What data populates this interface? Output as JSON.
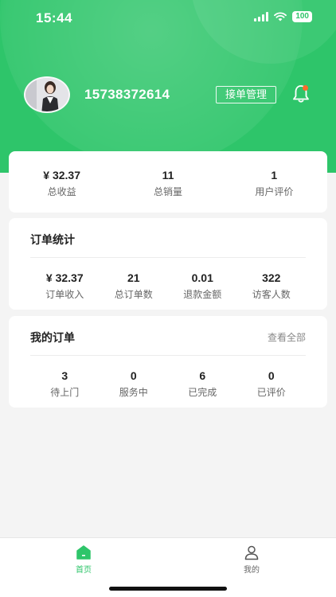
{
  "status_bar": {
    "time": "15:44",
    "battery": "100"
  },
  "profile": {
    "phone": "15738372614",
    "order_mgmt_label": "接单管理"
  },
  "summary": [
    {
      "value": "¥ 32.37",
      "label": "总收益"
    },
    {
      "value": "11",
      "label": "总销量"
    },
    {
      "value": "1",
      "label": "用户评价"
    }
  ],
  "order_stats": {
    "title": "订单统计",
    "items": [
      {
        "value": "¥ 32.37",
        "label": "订单收入"
      },
      {
        "value": "21",
        "label": "总订单数"
      },
      {
        "value": "0.01",
        "label": "退款金额"
      },
      {
        "value": "322",
        "label": "访客人数"
      }
    ]
  },
  "my_orders": {
    "title": "我的订单",
    "view_all": "查看全部",
    "items": [
      {
        "value": "3",
        "label": "待上门"
      },
      {
        "value": "0",
        "label": "服务中"
      },
      {
        "value": "6",
        "label": "已完成"
      },
      {
        "value": "0",
        "label": "已评价"
      }
    ]
  },
  "tabbar": {
    "home": "首页",
    "mine": "我的"
  },
  "colors": {
    "brand": "#2ec56a",
    "notification_dot": "#ff6a2b"
  },
  "icons": [
    "signal-icon",
    "wifi-icon",
    "bell-icon",
    "home-icon",
    "user-icon"
  ]
}
